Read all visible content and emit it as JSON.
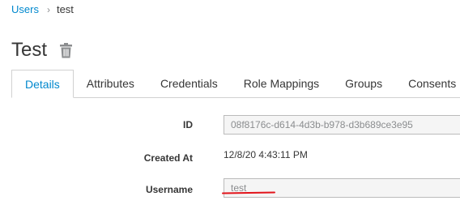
{
  "breadcrumb": {
    "parent": "Users",
    "current": "test"
  },
  "page": {
    "title": "Test"
  },
  "icons": {
    "delete": "trash-icon",
    "separator": "chevron-right-icon"
  },
  "tabs": [
    {
      "label": "Details",
      "active": true
    },
    {
      "label": "Attributes",
      "active": false
    },
    {
      "label": "Credentials",
      "active": false
    },
    {
      "label": "Role Mappings",
      "active": false
    },
    {
      "label": "Groups",
      "active": false
    },
    {
      "label": "Consents",
      "active": false
    }
  ],
  "form": {
    "id": {
      "label": "ID",
      "value": "08f8176c-d614-4d3b-b978-d3b689ce3e95"
    },
    "created_at": {
      "label": "Created At",
      "value": "12/8/20 4:43:11 PM"
    },
    "username": {
      "label": "Username",
      "value": "test"
    }
  },
  "colors": {
    "link": "#0088ce",
    "annotation": "#e2141b"
  }
}
